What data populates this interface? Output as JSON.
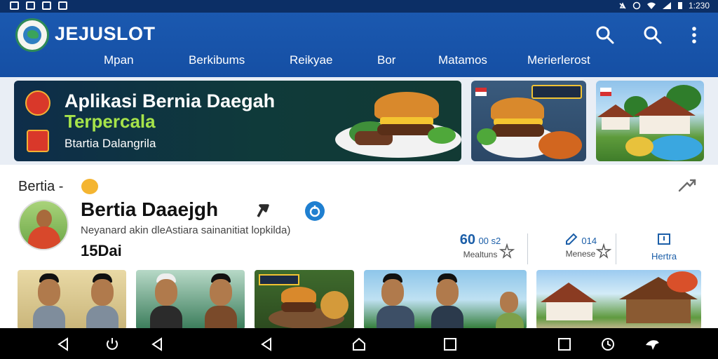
{
  "status_bar": {
    "time": "1:230"
  },
  "header": {
    "brand": "JEJUSLOT",
    "nav": [
      "Mpan",
      "Berkibums",
      "Reikyae",
      "Bor",
      "Matamos",
      "Merierlerost"
    ]
  },
  "hero": {
    "title": "Aplikasi Bernia Daegah",
    "subtitle": "Terpercala",
    "tagline": "Btartia Dalangrila"
  },
  "card2": {
    "sign": "0ॐ0ॐ"
  },
  "section": {
    "title": "Bertia -"
  },
  "profile": {
    "name": "Bertia Daaejgh",
    "description": "Neyanard akin dleAstiara sainanitiat lopkilda)",
    "count": "15Dai"
  },
  "stats": [
    {
      "value": "60",
      "sub": "00 s2",
      "label": "Mealtuns"
    },
    {
      "value": "0",
      "sub": "014",
      "label": "Menese"
    },
    {
      "value": "",
      "sub": "",
      "label": "Hertra"
    }
  ],
  "colors": {
    "header": "#1b59b0",
    "hero_accent": "#a6e34a",
    "stat_accent": "#1b5ea8",
    "status_bar": "#0c2f66"
  },
  "icons": {
    "header": [
      "search-icon",
      "search-icon",
      "more-vertical-icon"
    ],
    "navbar": [
      "back-icon",
      "power-icon",
      "back-icon",
      "back-icon",
      "home-icon",
      "recents-icon",
      "recents-icon",
      "clock-icon",
      "bird-icon"
    ]
  }
}
